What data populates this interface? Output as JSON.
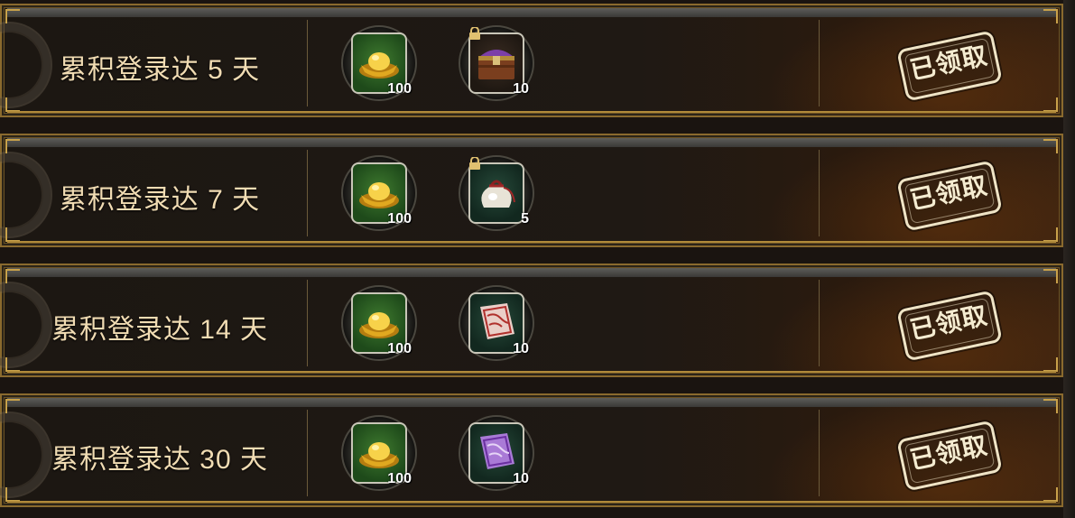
{
  "rows": [
    {
      "title": "累积登录达 5 天",
      "rewards": [
        {
          "icon": "gold-ingot-icon",
          "count": "100",
          "locked": false
        },
        {
          "icon": "purple-treasure-chest-icon",
          "count": "10",
          "locked": true
        }
      ],
      "status": "已领取"
    },
    {
      "title": "累积登录达 7 天",
      "rewards": [
        {
          "icon": "gold-ingot-icon",
          "count": "100",
          "locked": false
        },
        {
          "icon": "white-pouch-icon",
          "count": "5",
          "locked": true
        }
      ],
      "status": "已领取"
    },
    {
      "title": "累积登录达 14 天",
      "rewards": [
        {
          "icon": "gold-ingot-icon",
          "count": "100",
          "locked": false
        },
        {
          "icon": "red-scroll-icon",
          "count": "10",
          "locked": false
        }
      ],
      "status": "已领取"
    },
    {
      "title": "累积登录达 30 天",
      "rewards": [
        {
          "icon": "gold-ingot-icon",
          "count": "100",
          "locked": false
        },
        {
          "icon": "purple-scroll-icon",
          "count": "10",
          "locked": false
        }
      ],
      "status": "已领取"
    }
  ],
  "colors": {
    "title_text": "#f1dcb3",
    "border_gold": "#c9a24a",
    "slot_green": "#3f7a2f",
    "stamp": "#efe4c6"
  }
}
